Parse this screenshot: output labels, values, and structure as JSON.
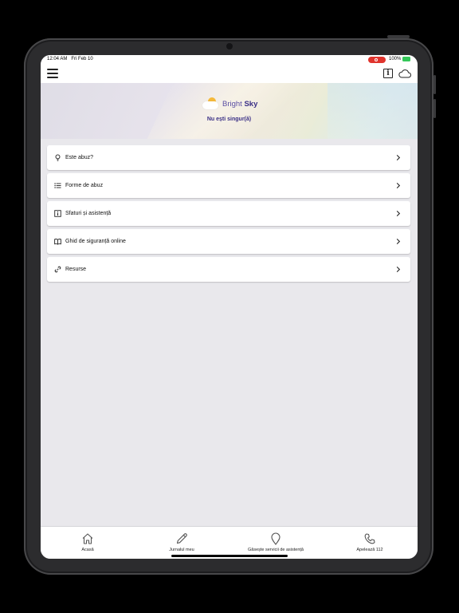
{
  "status_bar": {
    "time": "12:04 AM",
    "date": "Fri Feb 10",
    "battery": "100%"
  },
  "header": {
    "brand_light": "Bright ",
    "brand_bold": "Sky",
    "tagline": "Nu ești singur(ă)"
  },
  "menu": {
    "items": [
      {
        "label": "Este abuz?",
        "icon": "lightbulb-icon"
      },
      {
        "label": "Forme de abuz",
        "icon": "list-icon"
      },
      {
        "label": "Sfaturi și asistență",
        "icon": "info-box-icon"
      },
      {
        "label": "Ghid de siguranță online",
        "icon": "book-icon"
      },
      {
        "label": "Resurse",
        "icon": "link-icon"
      }
    ]
  },
  "tabbar": {
    "items": [
      {
        "label": "Acasă",
        "icon": "home-icon"
      },
      {
        "label": "Jurnalul meu",
        "icon": "pencil-icon"
      },
      {
        "label": "Găsește servicii de asistență",
        "icon": "location-pin-icon"
      },
      {
        "label": "Apelează 112",
        "icon": "phone-icon"
      }
    ]
  },
  "colors": {
    "brand": "#3a2f86",
    "background": "#e9e8ec",
    "record": "#e0342d",
    "battery": "#34c759"
  }
}
